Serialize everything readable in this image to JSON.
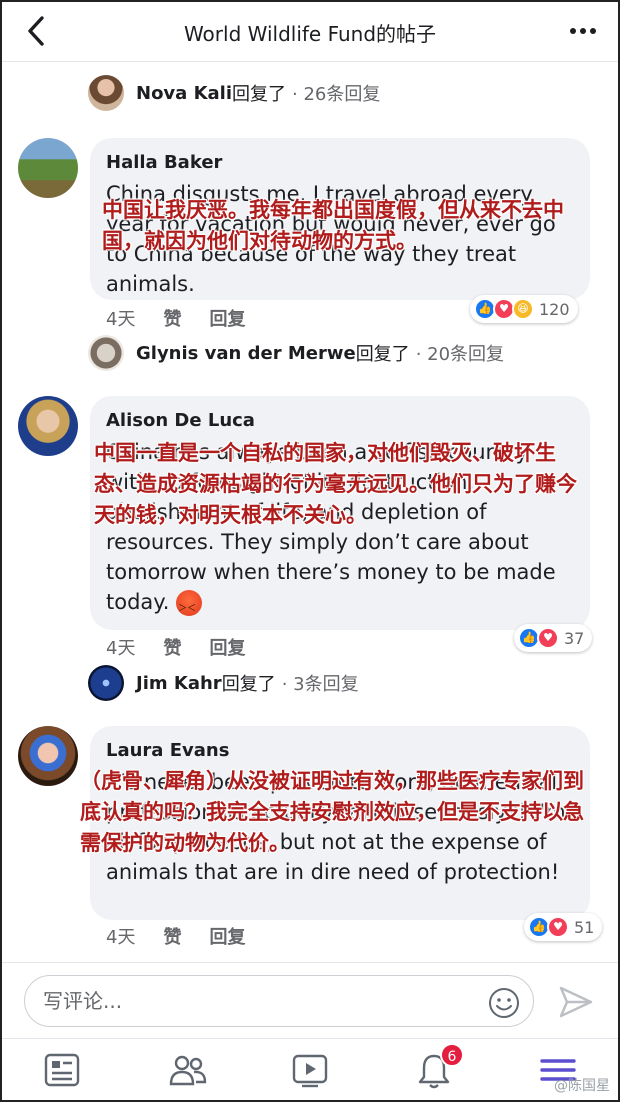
{
  "header": {
    "title": "World Wildlife Fund的帖子",
    "back_icon": "back-arrow-icon",
    "more_icon": "more-dots-icon"
  },
  "replies": [
    {
      "name": "Nova Kali",
      "suffix": "回复了",
      "count": "· 26条回复"
    },
    {
      "name": "Glynis van der Merwe",
      "suffix": "回复了",
      "count": "· 20条回复"
    },
    {
      "name": "Jim Kahr",
      "suffix": "回复了",
      "count": "· 3条回复"
    }
  ],
  "comments": [
    {
      "author": "Halla Baker",
      "text": "China disgusts me.  I travel abroad every year for vacation but would never, ever go to China because of the way they treat animals.",
      "translation": "中国让我厌恶。我每年都出国度假，但从来不去中国，就因为他们对待动物的方式。",
      "time": "4天",
      "like": "赞",
      "reply": "回复",
      "reaction_count": "120"
    },
    {
      "author": "Alison De Luca",
      "text": "China has always been a selfish country with no foresight of its destruction, abolishment of life, and depletion of resources.  They simply don’t care about tomorrow when there’s money to be made today.",
      "translation": "中国一直是一个自私的国家，对他们毁灭、破坏生态、造成资源枯竭的行为毫无远见。他们只为了赚今天的钱，对明天根本不关心。",
      "time": "4天",
      "like": "赞",
      "reply": "回复",
      "reaction_count": "37"
    },
    {
      "author": "Laura Evans",
      "text": "It's never been proven to work, do medical professionals actually take it seriously?! I'm all for placebos, but not at the expense of animals that are in dire need of protection!",
      "translation": "（虎骨、犀角）从没被证明过有效，那些医疗专家们到底认真的吗？我完全支持安慰剂效应，但是不支持以急需保护的动物为代价。",
      "time": "4天",
      "like": "赞",
      "reply": "回复",
      "reaction_count": "51"
    }
  ],
  "composer": {
    "placeholder": "写评论..."
  },
  "nav": {
    "notification_badge": "6"
  },
  "watermark": "@陈国星",
  "colors": {
    "like_blue": "#1877f2",
    "love_red": "#f33e58",
    "overlay_red": "#b01c1c",
    "nav_active": "#5b4fcf"
  }
}
